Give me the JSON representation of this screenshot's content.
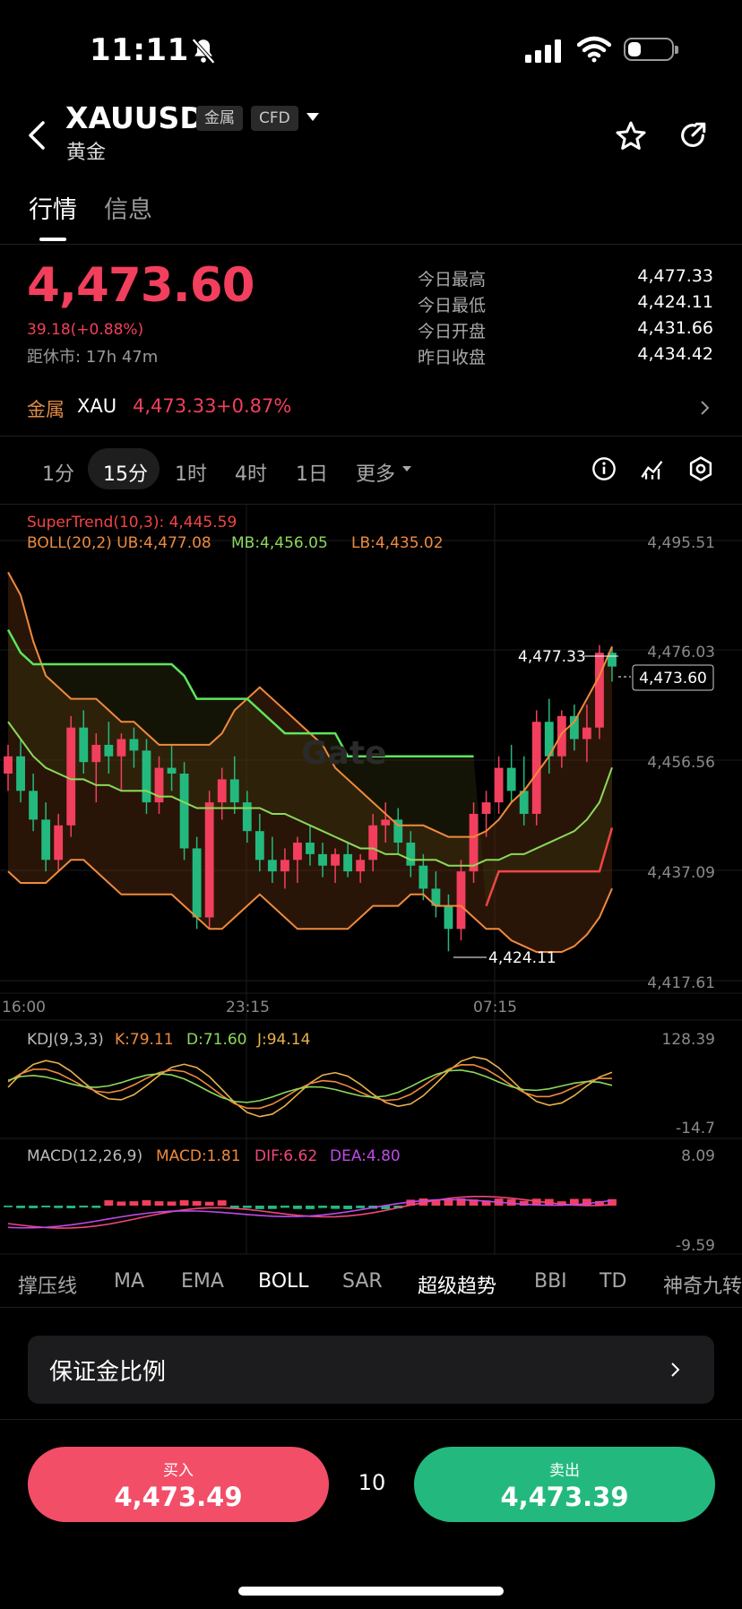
{
  "status": {
    "time": "11:11"
  },
  "header": {
    "symbol": "XAUUSD",
    "tag1": "金属",
    "tag2": "CFD",
    "name": "黄金"
  },
  "tabs": [
    "行情",
    "信息"
  ],
  "quote": {
    "price": "4,473.60",
    "change": "39.18(+0.88%)",
    "close_timer": "距休市: 17h 47m",
    "stats": [
      {
        "label": "今日最高",
        "value": "4,477.33"
      },
      {
        "label": "今日最低",
        "value": "4,424.11"
      },
      {
        "label": "今日开盘",
        "value": "4,431.66"
      },
      {
        "label": "昨日收盘",
        "value": "4,434.42"
      }
    ]
  },
  "related": {
    "category": "金属",
    "symbol": "XAU",
    "price": "4,473.33",
    "change": "+0.87%"
  },
  "timeframes": [
    "1分",
    "15分",
    "1时",
    "4时",
    "1日",
    "更多"
  ],
  "selected_timeframe": "15分",
  "chart_data": {
    "type": "candlestick",
    "main": {
      "legend_supertrend": "SuperTrend(10,3): 4,445.59",
      "legend_boll": "BOLL(20,2) UB:4,477.08",
      "legend_mb": "MB:4,456.05",
      "legend_lb": "LB:4,435.02",
      "y_ticks": [
        "4,495.51",
        "4,476.03",
        "4,456.56",
        "4,437.09",
        "4,417.61"
      ],
      "ylim": [
        4417.61,
        4495.51
      ],
      "x_ticks": [
        "16:00",
        "23:15",
        "07:15"
      ],
      "high_label": "4,477.33",
      "low_label": "4,424.11",
      "last_label": "4,473.60",
      "watermark": "Gate",
      "candles": [
        [
          4455,
          4460,
          4452,
          4458
        ],
        [
          4458,
          4461,
          4450,
          4452
        ],
        [
          4452,
          4455,
          4445,
          4447
        ],
        [
          4447,
          4450,
          4438,
          4440
        ],
        [
          4440,
          4448,
          4438,
          4446
        ],
        [
          4446,
          4465,
          4444,
          4463
        ],
        [
          4463,
          4466,
          4455,
          4457
        ],
        [
          4457,
          4462,
          4450,
          4460
        ],
        [
          4460,
          4464,
          4455,
          4458
        ],
        [
          4458,
          4462,
          4452,
          4461
        ],
        [
          4461,
          4463,
          4456,
          4459
        ],
        [
          4459,
          4461,
          4448,
          4450
        ],
        [
          4450,
          4458,
          4448,
          4456
        ],
        [
          4456,
          4460,
          4452,
          4455
        ],
        [
          4455,
          4457,
          4440,
          4442
        ],
        [
          4442,
          4444,
          4428,
          4430
        ],
        [
          4430,
          4452,
          4428,
          4450
        ],
        [
          4450,
          4456,
          4447,
          4454
        ],
        [
          4454,
          4458,
          4448,
          4450
        ],
        [
          4450,
          4452,
          4443,
          4445
        ],
        [
          4445,
          4448,
          4438,
          4440
        ],
        [
          4440,
          4444,
          4436,
          4438
        ],
        [
          4438,
          4442,
          4435,
          4440
        ],
        [
          4440,
          4444,
          4436,
          4443
        ],
        [
          4443,
          4446,
          4439,
          4441
        ],
        [
          4441,
          4443,
          4437,
          4439
        ],
        [
          4439,
          4442,
          4436,
          4441
        ],
        [
          4441,
          4443,
          4437,
          4438
        ],
        [
          4438,
          4441,
          4436,
          4440
        ],
        [
          4440,
          4448,
          4438,
          4446
        ],
        [
          4446,
          4450,
          4443,
          4447
        ],
        [
          4447,
          4449,
          4441,
          4443
        ],
        [
          4443,
          4445,
          4437,
          4439
        ],
        [
          4439,
          4441,
          4433,
          4435
        ],
        [
          4435,
          4438,
          4430,
          4432
        ],
        [
          4432,
          4434,
          4424.11,
          4428
        ],
        [
          4428,
          4440,
          4426,
          4438
        ],
        [
          4438,
          4450,
          4436,
          4448
        ],
        [
          4448,
          4452,
          4444,
          4450
        ],
        [
          4450,
          4458,
          4448,
          4456
        ],
        [
          4456,
          4460,
          4450,
          4452
        ],
        [
          4452,
          4458,
          4446,
          4448
        ],
        [
          4448,
          4466,
          4446,
          4464
        ],
        [
          4464,
          4468,
          4455,
          4458
        ],
        [
          4458,
          4466,
          4456,
          4465
        ],
        [
          4465,
          4467,
          4459,
          4461
        ],
        [
          4461,
          4467,
          4457,
          4463
        ],
        [
          4463,
          4477.33,
          4461,
          4476
        ],
        [
          4476,
          4477,
          4471,
          4473.6
        ]
      ],
      "boll_ub": [
        4490,
        4486,
        4478,
        4472,
        4470,
        4468,
        4468,
        4468,
        4466,
        4464,
        4464,
        4462,
        4460,
        4460,
        4460,
        4460,
        4460,
        4462,
        4466,
        4468,
        4470,
        4468,
        4466,
        4464,
        4462,
        4460,
        4456,
        4454,
        4452,
        4450,
        4448,
        4446,
        4446,
        4446,
        4445,
        4444,
        4444,
        4444,
        4445,
        4447,
        4450,
        4452,
        4455,
        4458,
        4462,
        4464,
        4468,
        4472,
        4477.08
      ],
      "boll_mb": [
        4464,
        4461,
        4458,
        4456,
        4455,
        4454,
        4454,
        4453,
        4453,
        4452,
        4452,
        4452,
        4451,
        4451,
        4450,
        4449,
        4449,
        4449,
        4449,
        4449,
        4449,
        4448,
        4448,
        4447,
        4446,
        4445,
        4444,
        4443,
        4442,
        4442,
        4441,
        4441,
        4440,
        4440,
        4440,
        4439,
        4439,
        4439,
        4440,
        4440,
        4441,
        4441,
        4442,
        4443,
        4444,
        4445,
        4447,
        4450,
        4456.05
      ],
      "boll_lb": [
        4438,
        4436,
        4436,
        4436,
        4438,
        4440,
        4440,
        4438,
        4436,
        4434,
        4434,
        4434,
        4434,
        4434,
        4432,
        4430,
        4428,
        4428,
        4430,
        4432,
        4434,
        4432,
        4430,
        4428,
        4428,
        4428,
        4428,
        4428,
        4430,
        4432,
        4432,
        4432,
        4434,
        4434,
        4432,
        4432,
        4432,
        4430,
        4428,
        4428,
        4426,
        4425,
        4424,
        4424,
        4424,
        4425,
        4427,
        4430,
        4435.02
      ],
      "supertrend": [
        4480,
        4476,
        4474,
        4474,
        4474,
        4474,
        4474,
        4474,
        4474,
        4474,
        4474,
        4474,
        4474,
        4474,
        4472,
        4468,
        4468,
        4468,
        4468,
        4468,
        4466,
        4464,
        4462,
        4462,
        4462,
        4462,
        4462,
        4458,
        4458,
        4458,
        4458,
        4458,
        4458,
        4458,
        4458,
        4458,
        4458,
        4458,
        4432,
        4438,
        4438,
        4438,
        4438,
        4438,
        4438,
        4438,
        4438,
        4438,
        4445.59
      ]
    },
    "kdj": {
      "legend": "KDJ(9,3,3)",
      "k": "K:79.11",
      "d": "D:71.60",
      "j": "J:94.14",
      "ymax": "128.39",
      "ymin": "-14.7"
    },
    "macd": {
      "legend": "MACD(12,26,9)",
      "macd": "MACD:1.81",
      "dif": "DIF:6.62",
      "dea": "DEA:4.80",
      "ymax": "8.09",
      "ymin": "-9.59"
    }
  },
  "indicators": [
    "撑压线",
    "MA",
    "EMA",
    "BOLL",
    "SAR",
    "超级趋势",
    "BBI",
    "TD",
    "神奇九转"
  ],
  "active_indicators": [
    "BOLL",
    "超级趋势"
  ],
  "margin": {
    "label": "保证金比例"
  },
  "trade": {
    "buy_label": "买入",
    "buy_price": "4,473.49",
    "qty": "10",
    "sell_label": "卖出",
    "sell_price": "4,473.39"
  },
  "colors": {
    "up": "#f23f5d",
    "down": "#23b97e",
    "boll_ub": "#f08a3c",
    "boll_mb": "#8bd95a",
    "supertrend_up": "#5ce65c",
    "supertrend_dn": "#f24545"
  }
}
